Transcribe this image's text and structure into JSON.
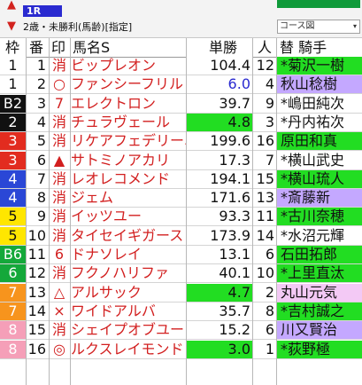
{
  "header": {
    "race_number": "1R",
    "race_info": "2歳・未勝利(馬齢)[指定]",
    "course_label": "コース図",
    "course_chevron": "▾",
    "arrow_up": "▲",
    "arrow_down": "▼"
  },
  "columns": {
    "waku": "枠",
    "uma": "番",
    "mark": "印",
    "name": "馬名S",
    "odds": "単勝",
    "pop": "人",
    "jockey": "替 騎手"
  },
  "colors": {
    "waku": {
      "1": {
        "bg": "#ffffff",
        "fg": "#111111"
      },
      "2": {
        "bg": "#111111",
        "fg": "#ffffff"
      },
      "3": {
        "bg": "#e22c1f",
        "fg": "#ffffff"
      },
      "4": {
        "bg": "#2a47d6",
        "fg": "#ffffff"
      },
      "5": {
        "bg": "#ffe600",
        "fg": "#111111"
      },
      "6": {
        "bg": "#14a83a",
        "fg": "#ffffff"
      },
      "7": {
        "bg": "#f7941d",
        "fg": "#ffffff"
      },
      "8": {
        "bg": "#f59fb8",
        "fg": "#ffffff"
      }
    }
  },
  "rows": [
    {
      "waku": "1",
      "waku_color": "1",
      "uma": "1",
      "mark": "消",
      "name": "ビップレオン",
      "odds": "104.4",
      "odds_bg": "#ffffff",
      "odds_fg": "#111111",
      "pop": "12",
      "jockey": "*菊沢一樹",
      "jockey_bg": "#22dd22",
      "jockey_fg": "#111111"
    },
    {
      "waku": "1",
      "waku_color": "1",
      "uma": "2",
      "mark": "○",
      "name": "ファンシーフリル",
      "odds": "6.0",
      "odds_bg": "#ffffff",
      "odds_fg": "#2a2ad0",
      "pop": "4",
      "jockey": "秋山稔樹",
      "jockey_bg": "#c4a8ff",
      "jockey_fg": "#111111"
    },
    {
      "waku": "B2",
      "waku_color": "2",
      "uma": "3",
      "mark": "7",
      "name": "エレクトロン",
      "odds": "39.7",
      "odds_bg": "#ffffff",
      "odds_fg": "#111111",
      "pop": "9",
      "jockey": "*嶋田純次",
      "jockey_bg": "#ffffff",
      "jockey_fg": "#111111"
    },
    {
      "waku": "2",
      "waku_color": "2",
      "uma": "4",
      "mark": "消",
      "name": "チュラヴェール",
      "odds": "4.8",
      "odds_bg": "#22dd22",
      "odds_fg": "#111111",
      "pop": "3",
      "jockey": "*丹内祐次",
      "jockey_bg": "#ffffff",
      "jockey_fg": "#111111"
    },
    {
      "waku": "3",
      "waku_color": "3",
      "uma": "5",
      "mark": "消",
      "name": "リケアフェデリーニ",
      "odds": "199.6",
      "odds_bg": "#ffffff",
      "odds_fg": "#111111",
      "pop": "16",
      "jockey": "原田和真",
      "jockey_bg": "#22dd22",
      "jockey_fg": "#111111"
    },
    {
      "waku": "3",
      "waku_color": "3",
      "uma": "6",
      "mark": "▲",
      "name": "サトミノアカリ",
      "odds": "17.3",
      "odds_bg": "#ffffff",
      "odds_fg": "#111111",
      "pop": "7",
      "jockey": "*横山武史",
      "jockey_bg": "#ffffff",
      "jockey_fg": "#111111"
    },
    {
      "waku": "4",
      "waku_color": "4",
      "uma": "7",
      "mark": "消",
      "name": "レオレコメンド",
      "odds": "194.1",
      "odds_bg": "#ffffff",
      "odds_fg": "#111111",
      "pop": "15",
      "jockey": "*横山琉人",
      "jockey_bg": "#22dd22",
      "jockey_fg": "#111111"
    },
    {
      "waku": "4",
      "waku_color": "4",
      "uma": "8",
      "mark": "消",
      "name": "ジェム",
      "odds": "171.6",
      "odds_bg": "#ffffff",
      "odds_fg": "#111111",
      "pop": "13",
      "jockey": "*斎藤新",
      "jockey_bg": "#c4a8ff",
      "jockey_fg": "#111111"
    },
    {
      "waku": "5",
      "waku_color": "5",
      "uma": "9",
      "mark": "消",
      "name": "イッツユー",
      "odds": "93.3",
      "odds_bg": "#ffffff",
      "odds_fg": "#111111",
      "pop": "11",
      "jockey": "*古川奈穂",
      "jockey_bg": "#22dd22",
      "jockey_fg": "#111111"
    },
    {
      "waku": "5",
      "waku_color": "5",
      "uma": "10",
      "mark": "消",
      "name": "タイセイギガース",
      "odds": "173.9",
      "odds_bg": "#ffffff",
      "odds_fg": "#111111",
      "pop": "14",
      "jockey": "*水沼元輝",
      "jockey_bg": "#ffffff",
      "jockey_fg": "#111111"
    },
    {
      "waku": "B6",
      "waku_color": "6",
      "uma": "11",
      "mark": "6",
      "name": "ドナソレイ",
      "odds": "13.1",
      "odds_bg": "#ffffff",
      "odds_fg": "#111111",
      "pop": "6",
      "jockey": "石田拓郎",
      "jockey_bg": "#22dd22",
      "jockey_fg": "#111111"
    },
    {
      "waku": "6",
      "waku_color": "6",
      "uma": "12",
      "mark": "消",
      "name": "フクノハリファ",
      "odds": "40.1",
      "odds_bg": "#ffffff",
      "odds_fg": "#111111",
      "pop": "10",
      "jockey": "*上里直汰",
      "jockey_bg": "#22dd22",
      "jockey_fg": "#111111"
    },
    {
      "waku": "7",
      "waku_color": "7",
      "uma": "13",
      "mark": "△",
      "name": "アルサック",
      "odds": "4.7",
      "odds_bg": "#22dd22",
      "odds_fg": "#111111",
      "pop": "2",
      "jockey": "丸山元気",
      "jockey_bg": "#f3c9f5",
      "jockey_fg": "#111111"
    },
    {
      "waku": "7",
      "waku_color": "7",
      "uma": "14",
      "mark": "×",
      "name": "ワイドアルバ",
      "odds": "35.7",
      "odds_bg": "#ffffff",
      "odds_fg": "#111111",
      "pop": "8",
      "jockey": "*吉村誠之",
      "jockey_bg": "#22dd22",
      "jockey_fg": "#111111"
    },
    {
      "waku": "8",
      "waku_color": "8",
      "uma": "15",
      "mark": "消",
      "name": "シェイプオブユー",
      "odds": "15.2",
      "odds_bg": "#ffffff",
      "odds_fg": "#111111",
      "pop": "6",
      "jockey": "川又賢治",
      "jockey_bg": "#c4a8ff",
      "jockey_fg": "#111111"
    },
    {
      "waku": "8",
      "waku_color": "8",
      "uma": "16",
      "mark": "◎",
      "name": "ルクスレイモンド",
      "odds": "3.0",
      "odds_bg": "#22dd22",
      "odds_fg": "#111111",
      "pop": "1",
      "jockey": "*荻野極",
      "jockey_bg": "#22dd22",
      "jockey_fg": "#111111"
    }
  ]
}
